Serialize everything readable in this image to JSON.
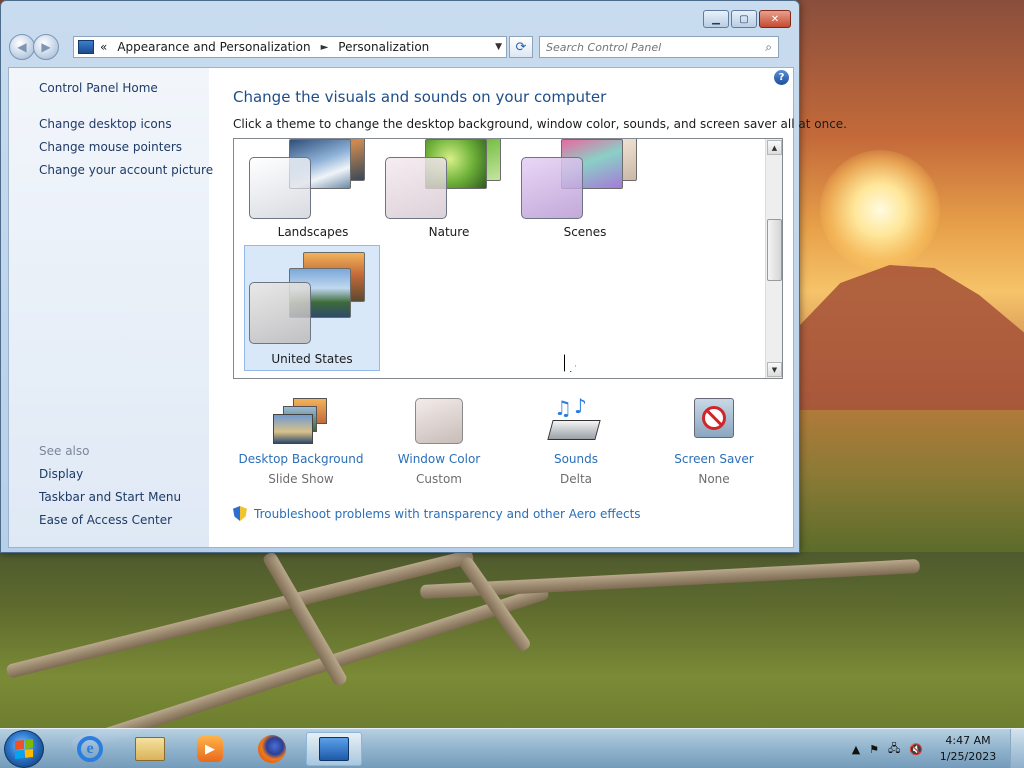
{
  "window": {
    "buttons": {
      "minimize": "▁",
      "maximize": "▢",
      "close": "✕"
    }
  },
  "navbar": {
    "back_icon": "◀",
    "forward_icon": "▶",
    "breadcrumb_prefix": "«",
    "breadcrumb": [
      "Appearance and Personalization",
      "Personalization"
    ],
    "breadcrumb_separator": "►",
    "dropdown_icon": "▼",
    "refresh_icon": "⟳",
    "search_placeholder": "Search Control Panel",
    "search_icon": "⌕"
  },
  "sidebar": {
    "home": "Control Panel Home",
    "links": [
      "Change desktop icons",
      "Change mouse pointers",
      "Change your account picture"
    ],
    "see_also_label": "See also",
    "see_also": [
      "Display",
      "Taskbar and Start Menu",
      "Ease of Access Center"
    ]
  },
  "main": {
    "help_icon": "?",
    "title": "Change the visuals and sounds on your computer",
    "subtitle": "Click a theme to change the desktop background, window color, sounds, and screen saver all at once.",
    "themes": [
      {
        "name": "Landscapes",
        "selected": false
      },
      {
        "name": "Nature",
        "selected": false
      },
      {
        "name": "Scenes",
        "selected": false
      },
      {
        "name": "United States",
        "selected": true
      }
    ],
    "scroll_up": "▲",
    "scroll_down": "▼",
    "settings": [
      {
        "label": "Desktop Background",
        "value": "Slide Show"
      },
      {
        "label": "Window Color",
        "value": "Custom"
      },
      {
        "label": "Sounds",
        "value": "Delta"
      },
      {
        "label": "Screen Saver",
        "value": "None"
      }
    ],
    "troubleshoot": "Troubleshoot problems with transparency and other Aero effects"
  },
  "taskbar": {
    "pinned": [
      "internet-explorer-icon",
      "windows-explorer-icon",
      "media-player-icon",
      "firefox-icon",
      "control-panel-icon"
    ],
    "tray_icons": {
      "overflow": "▲",
      "flag": "⚑",
      "network": "🖧",
      "volume": "🔇"
    },
    "time": "4:47 AM",
    "date": "1/25/2023"
  },
  "colors": {
    "accent": "#1e4e8a",
    "link": "#2b6fb8",
    "selected_bg": "#d8e8f9"
  }
}
